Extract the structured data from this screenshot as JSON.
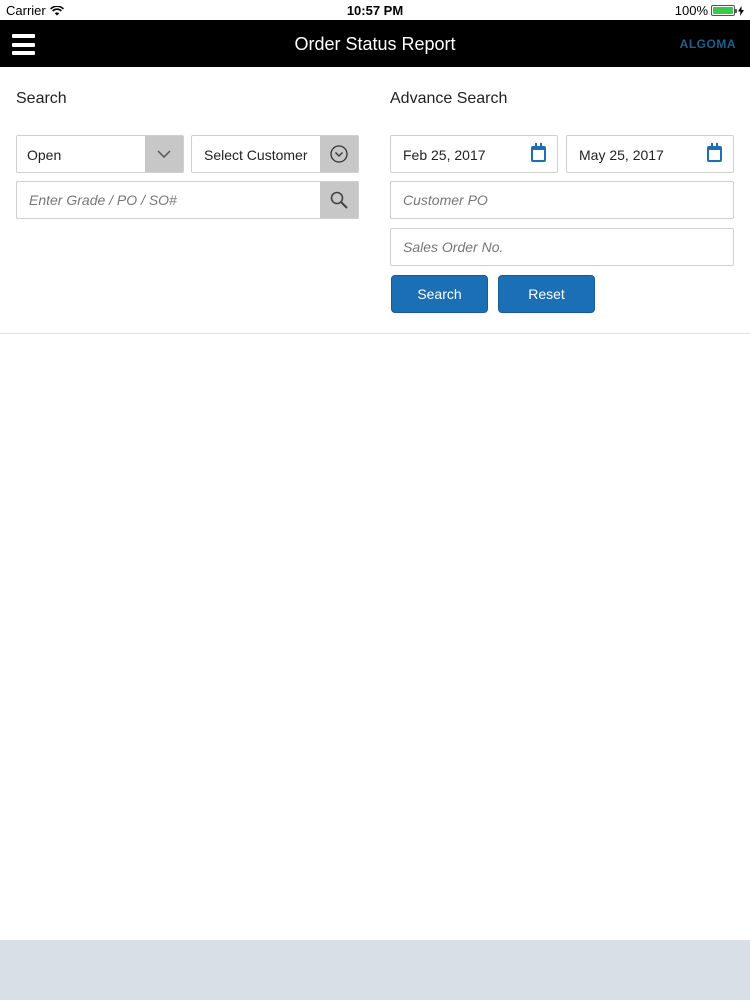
{
  "status_bar": {
    "carrier": "Carrier",
    "time": "10:57 PM",
    "battery": "100%"
  },
  "nav": {
    "title": "Order Status Report",
    "logo": "ALGOMA"
  },
  "search": {
    "title": "Search",
    "status_value": "Open",
    "customer_value": "Select Customer",
    "query_placeholder": "Enter Grade / PO / SO#"
  },
  "advance_search": {
    "title": "Advance Search",
    "from_date": "Feb 25, 2017",
    "to_date": "May 25, 2017",
    "customer_po_placeholder": "Customer PO",
    "sales_order_placeholder": "Sales Order No.",
    "search_label": "Search",
    "reset_label": "Reset"
  },
  "colors": {
    "accent": "#1a6fb5",
    "nav_bg": "#000000",
    "footer_bg": "#d9dfe6"
  }
}
